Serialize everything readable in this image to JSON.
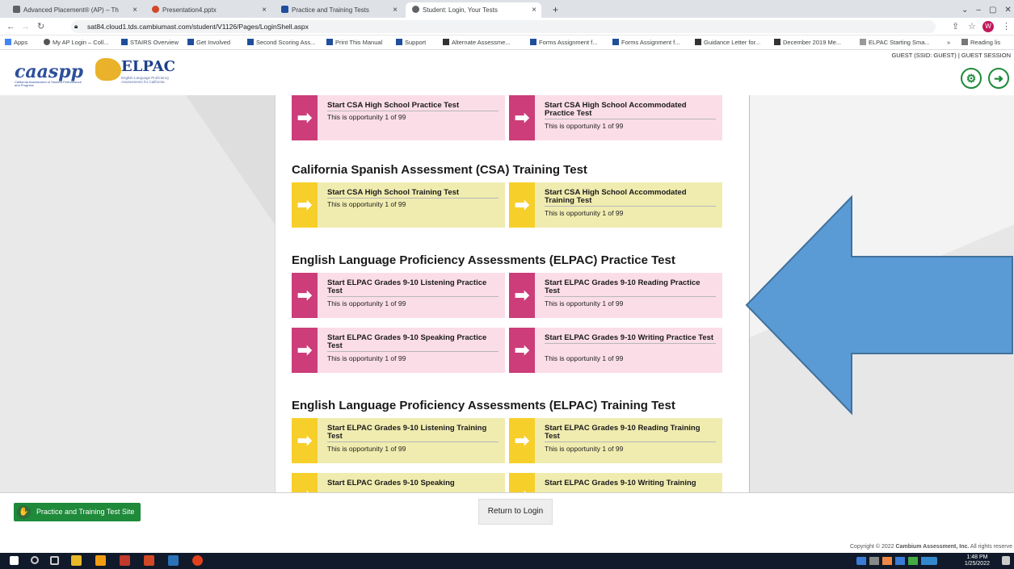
{
  "browser": {
    "tabs": [
      {
        "label": "Advanced Placement® (AP) – Th",
        "color": "#5f6368"
      },
      {
        "label": "Presentation4.pptx",
        "color": "#d24726"
      },
      {
        "label": "Practice and Training Tests",
        "color": "#1f4e9c"
      },
      {
        "label": "Student: Login, Your Tests",
        "color": "#5f6368"
      }
    ],
    "new_tab": "+",
    "url": "sat84.cloud1.tds.cambiumast.com/student/V1126/Pages/LoginShell.aspx",
    "bookmarks": [
      "Apps",
      "My AP Login – Coll...",
      "STAIRS Overview",
      "Get Involved",
      "Second Scoring Ass...",
      "Print This Manual",
      "Support",
      "Alternate Assessme...",
      "Forms Assignment f...",
      "Forms Assignment f...",
      "Guidance Letter for...",
      "December 2019 Me...",
      "ELPAC Starting Sma...",
      "»",
      "Reading lis"
    ],
    "profile_initial": "W"
  },
  "header": {
    "logo_caaspp": "caaspp",
    "logo_caaspp_sub": "California Assessment of Student Performance and Progress",
    "logo_elpac": "ELPAC",
    "logo_elpac_sub": "English Language Proficiency Assessments for California",
    "guest_info": "GUEST (SSID: GUEST) | GUEST SESSION"
  },
  "sections": {
    "top_cards": [
      {
        "title": "Start CSA High School Practice Test",
        "opportunity": "This is opportunity 1 of 99"
      },
      {
        "title": "Start CSA High School Accommodated Practice Test",
        "opportunity": "This is opportunity 1 of 99"
      }
    ],
    "csa_training": {
      "title": "California Spanish Assessment (CSA) Training Test",
      "cards": [
        {
          "title": "Start CSA High School Training Test",
          "opportunity": "This is opportunity 1 of 99"
        },
        {
          "title": "Start CSA High School Accommodated Training Test",
          "opportunity": "This is opportunity 1 of 99"
        }
      ]
    },
    "elpac_practice": {
      "title": "English Language Proficiency Assessments (ELPAC) Practice Test",
      "cards": [
        {
          "title": "Start ELPAC Grades 9-10 Listening Practice Test",
          "opportunity": "This is opportunity 1 of 99"
        },
        {
          "title": "Start ELPAC Grades 9-10 Reading Practice Test",
          "opportunity": "This is opportunity 1 of 99"
        },
        {
          "title": "Start ELPAC Grades 9-10 Speaking Practice Test",
          "opportunity": "This is opportunity 1 of 99"
        },
        {
          "title": "Start ELPAC Grades 9-10 Writing Practice Test",
          "opportunity": "This is opportunity 1 of 99"
        }
      ]
    },
    "elpac_training": {
      "title": "English Language Proficiency Assessments (ELPAC) Training Test",
      "cards": [
        {
          "title": "Start ELPAC Grades 9-10 Listening Training Test",
          "opportunity": "This is opportunity 1 of 99"
        },
        {
          "title": "Start ELPAC Grades 9-10 Reading Training Test",
          "opportunity": "This is opportunity 1 of 99"
        },
        {
          "title": "Start ELPAC Grades 9-10 Speaking",
          "opportunity": ""
        },
        {
          "title": "Start ELPAC Grades 9-10 Writing Training",
          "opportunity": ""
        }
      ]
    }
  },
  "footer": {
    "site_button": "Practice and Training Test Site",
    "return_button": "Return to Login",
    "copyright_prefix": "Copyright © 2022 ",
    "copyright_company": "Cambium Assessment, Inc.",
    "copyright_suffix": " All rights reserve"
  },
  "taskbar": {
    "time": "1:48 PM",
    "date": "1/25/2022"
  },
  "colors": {
    "practice_accent": "#cc3d79",
    "training_accent": "#f7cf2a",
    "annotation_arrow": "#5b9bd5"
  }
}
